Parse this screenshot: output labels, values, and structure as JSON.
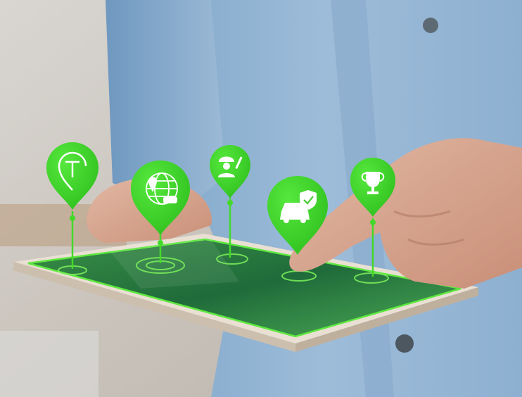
{
  "scene": {
    "subject": "tablet-with-floating-map-pins",
    "accent_color": "#3fd42a",
    "pins": [
      {
        "icon": "taxi-t-icon"
      },
      {
        "icon": "globe-location-car-icon"
      },
      {
        "icon": "worker-wrench-icon"
      },
      {
        "icon": "car-shield-check-icon"
      },
      {
        "icon": "trophy-icon"
      }
    ]
  }
}
